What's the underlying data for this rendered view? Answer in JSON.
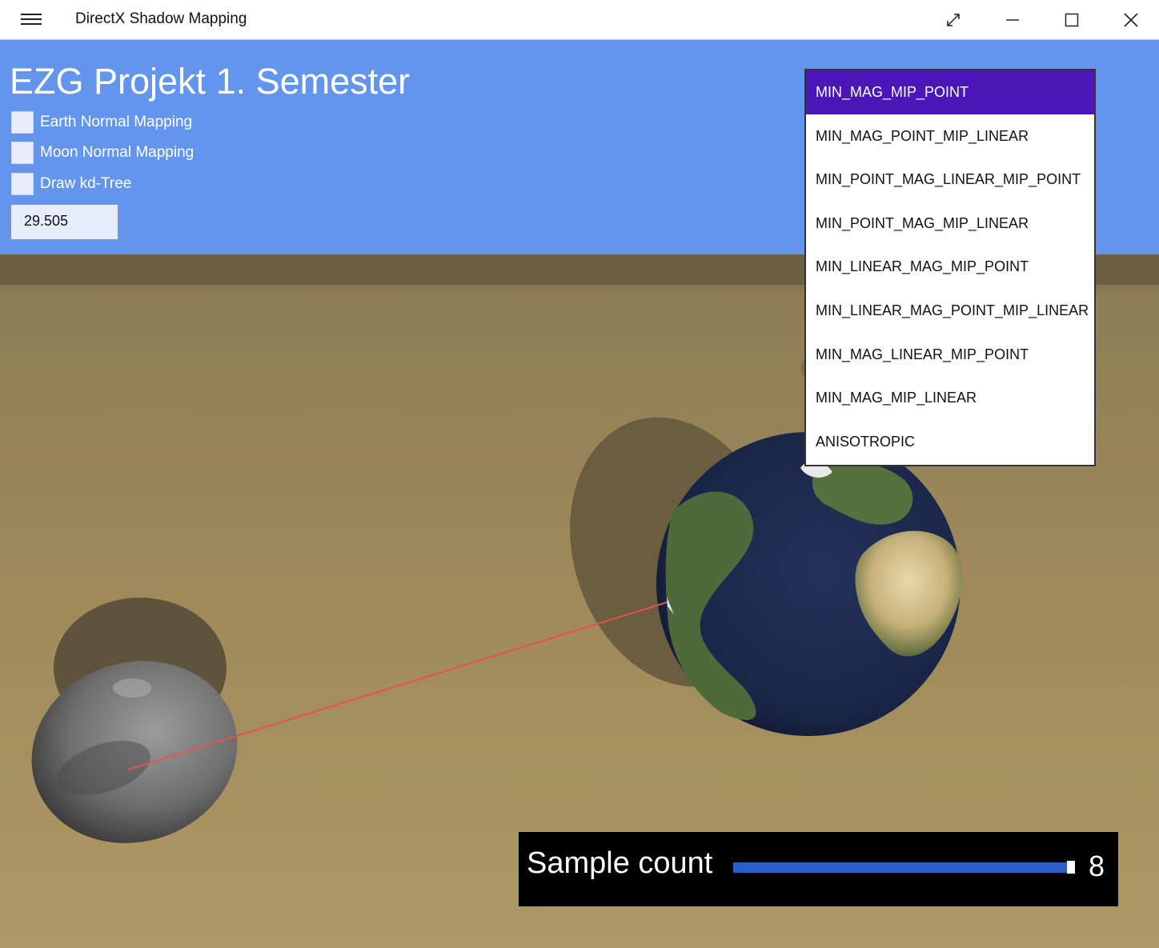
{
  "window": {
    "title": "DirectX Shadow Mapping",
    "menu_icon": "hamburger-icon",
    "controls": [
      "expand-icon",
      "minimize-icon",
      "maximize-icon",
      "close-icon"
    ]
  },
  "header": {
    "heading": "EZG Projekt 1. Semester",
    "checkboxes": [
      {
        "label": "Earth Normal Mapping",
        "checked": false
      },
      {
        "label": "Moon Normal Mapping",
        "checked": false
      },
      {
        "label": "Draw kd-Tree",
        "checked": false
      }
    ],
    "fps_value": "29.505"
  },
  "filter_dropdown": {
    "selected": "MIN_MAG_MIP_POINT",
    "options": [
      "MIN_MAG_MIP_POINT",
      "MIN_MAG_POINT_MIP_LINEAR",
      "MIN_POINT_MAG_LINEAR_MIP_POINT",
      "MIN_POINT_MAG_MIP_LINEAR",
      "MIN_LINEAR_MAG_MIP_POINT",
      "MIN_LINEAR_MAG_POINT_MIP_LINEAR",
      "MIN_MAG_LINEAR_MIP_POINT",
      "MIN_MAG_MIP_LINEAR",
      "ANISOTROPIC"
    ]
  },
  "sample_count": {
    "label": "Sample count",
    "value": "8",
    "slider_fraction": 1.0
  },
  "colors": {
    "header_bg": "#6495ed",
    "selected_item": "#4b17b9",
    "slider": "#2b5fc7",
    "ground": "#a8925f",
    "ray": "#e8524a"
  }
}
